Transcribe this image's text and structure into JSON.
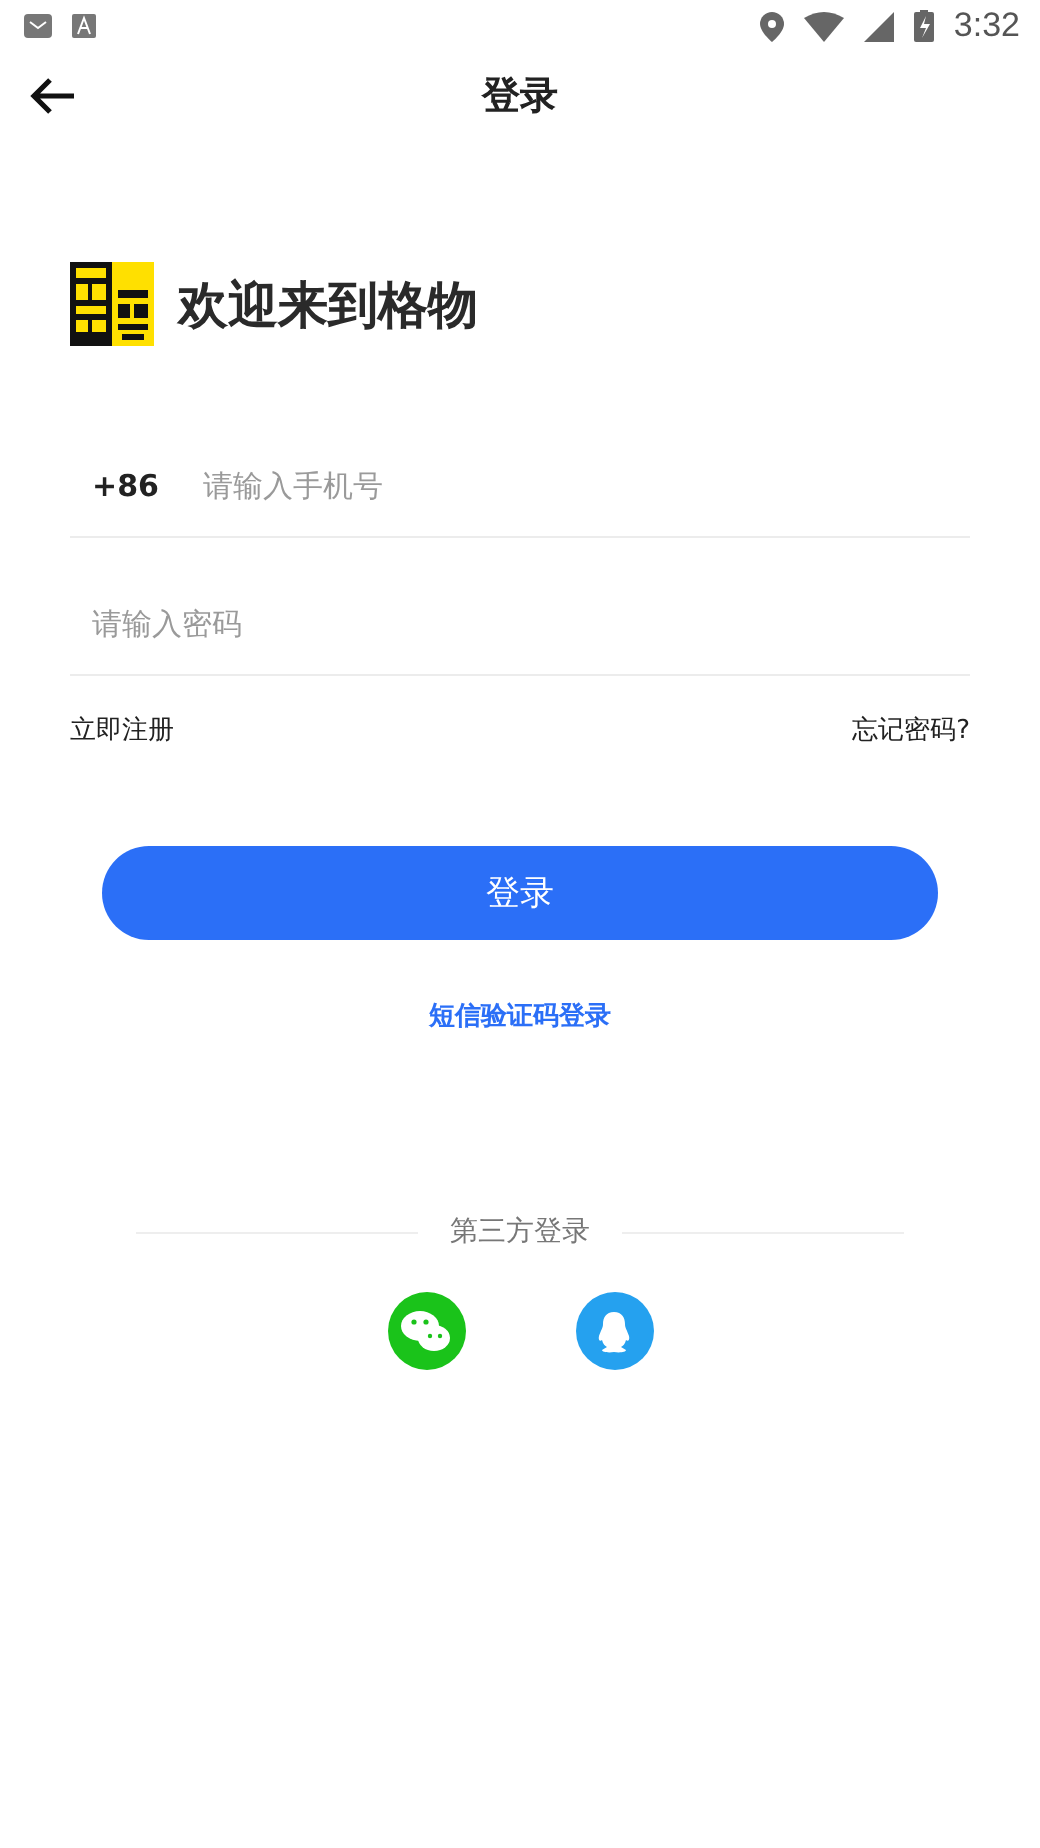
{
  "status_bar": {
    "time": "3:32"
  },
  "header": {
    "title": "登录"
  },
  "welcome": {
    "text": "欢迎来到格物"
  },
  "phone_field": {
    "prefix": "+86",
    "placeholder": "请输入手机号"
  },
  "password_field": {
    "placeholder": "请输入密码"
  },
  "links": {
    "register": "立即注册",
    "forgot": "忘记密码?"
  },
  "login_button": "登录",
  "sms_login": "短信验证码登录",
  "third_party": {
    "label": "第三方登录",
    "providers": [
      {
        "kind": "wechat",
        "color": "#1ac31a"
      },
      {
        "kind": "qq",
        "color": "#25a1ef"
      }
    ]
  }
}
